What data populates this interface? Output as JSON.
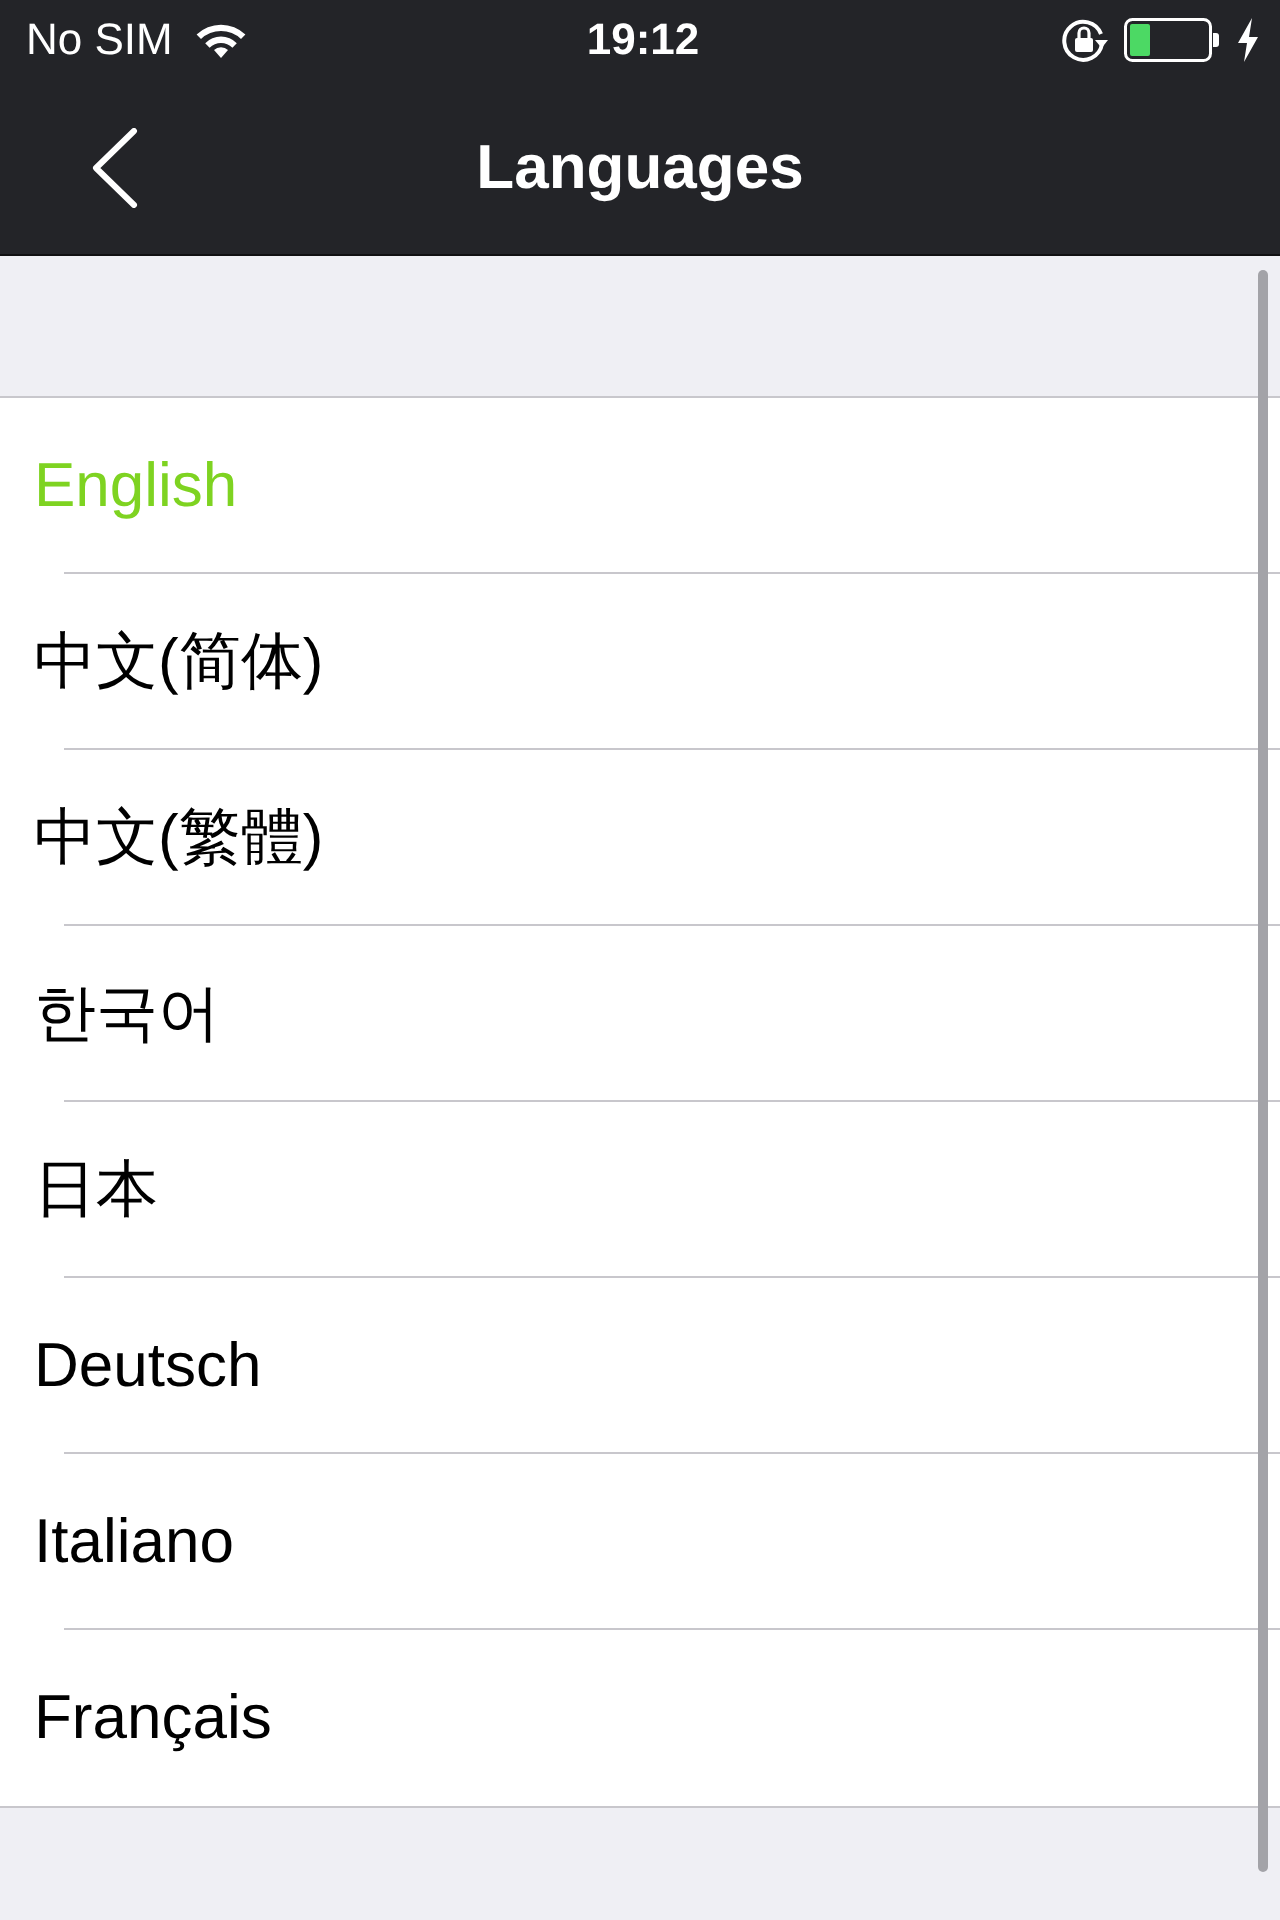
{
  "status_bar": {
    "carrier": "No SIM",
    "time": "19:12"
  },
  "nav_bar": {
    "title": "Languages"
  },
  "languages": [
    {
      "label": "English",
      "selected": true
    },
    {
      "label": "中文(简体)",
      "selected": false
    },
    {
      "label": "中文(繁體)",
      "selected": false
    },
    {
      "label": "한국어",
      "selected": false
    },
    {
      "label": "日本",
      "selected": false
    },
    {
      "label": "Deutsch",
      "selected": false
    },
    {
      "label": "Italiano",
      "selected": false
    },
    {
      "label": "Français",
      "selected": false
    }
  ]
}
